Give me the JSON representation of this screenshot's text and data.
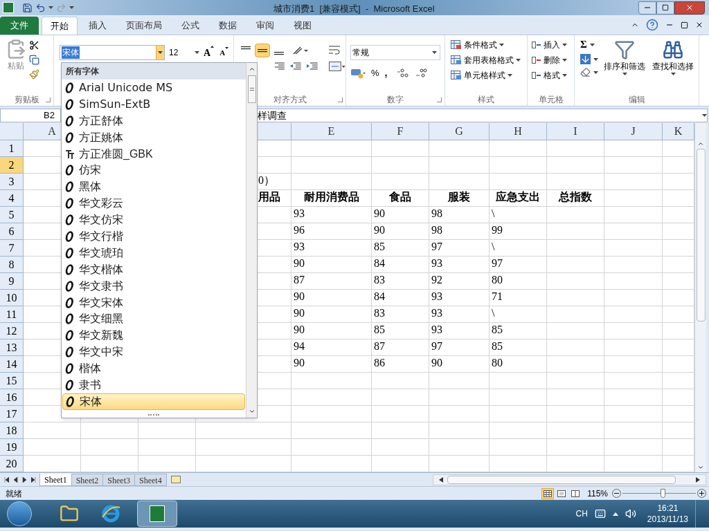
{
  "window": {
    "title": "城市消费1  [兼容模式]  -  Microsoft Excel"
  },
  "ribbon_tabs": [
    {
      "label": "文件",
      "kind": "file",
      "selected": false
    },
    {
      "label": "开始",
      "kind": "tab",
      "selected": true
    },
    {
      "label": "插入",
      "kind": "tab",
      "selected": false
    },
    {
      "label": "页面布局",
      "kind": "tab",
      "selected": false
    },
    {
      "label": "公式",
      "kind": "tab",
      "selected": false
    },
    {
      "label": "数据",
      "kind": "tab",
      "selected": false
    },
    {
      "label": "审阅",
      "kind": "tab",
      "selected": false
    },
    {
      "label": "视图",
      "kind": "tab",
      "selected": false
    }
  ],
  "clipboard": {
    "paste": "粘贴",
    "label": "剪贴板"
  },
  "font": {
    "name": "宋体",
    "size": "12",
    "grow": "A",
    "shrink": "A"
  },
  "alignment": {
    "label": "对齐方式",
    "vertical": [
      {
        "kind": "top",
        "selected": false
      },
      {
        "kind": "middle",
        "selected": true
      },
      {
        "kind": "bottom",
        "selected": false
      }
    ]
  },
  "number": {
    "format": "常规",
    "percent": "%",
    "comma": ",",
    "label": "数字"
  },
  "styles": {
    "items": [
      "条件格式",
      "套用表格格式",
      "单元格样式"
    ],
    "label": "样式"
  },
  "cells_group": {
    "items": [
      "插入",
      "删除",
      "格式"
    ],
    "label": "单元格"
  },
  "editing": {
    "sum": "Σ",
    "sort": "排序和筛选",
    "find": "查找和选择",
    "label": "编辑"
  },
  "name_box": "B2",
  "formula": "样调查",
  "columns": [
    "A",
    "E",
    "F",
    "G",
    "H",
    "I",
    "J",
    "K"
  ],
  "row_headers": [
    {
      "label": "1",
      "selected": false
    },
    {
      "label": "2",
      "selected": true
    },
    {
      "label": "3",
      "selected": false
    },
    {
      "label": "4",
      "selected": false
    },
    {
      "label": "5",
      "selected": false
    },
    {
      "label": "6",
      "selected": false
    },
    {
      "label": "7",
      "selected": false
    },
    {
      "label": "8",
      "selected": false
    },
    {
      "label": "9",
      "selected": false
    },
    {
      "label": "10",
      "selected": false
    },
    {
      "label": "11",
      "selected": false
    },
    {
      "label": "12",
      "selected": false
    },
    {
      "label": "13",
      "selected": false
    },
    {
      "label": "14",
      "selected": false
    },
    {
      "label": "15",
      "selected": false
    },
    {
      "label": "16",
      "selected": false
    },
    {
      "label": "17",
      "selected": false
    },
    {
      "label": "18",
      "selected": false
    },
    {
      "label": "19",
      "selected": false
    },
    {
      "label": "20",
      "selected": false
    }
  ],
  "sheet": {
    "title_fragment": "0）",
    "header_row": [
      "用品",
      "耐用消费品",
      "食品",
      "服装",
      "应急支出",
      "总指数"
    ],
    "data_rows": [
      [
        "93",
        "90",
        "98",
        "\\"
      ],
      [
        "96",
        "90",
        "98",
        "99"
      ],
      [
        "93",
        "85",
        "97",
        "\\"
      ],
      [
        "90",
        "84",
        "93",
        "97"
      ],
      [
        "87",
        "83",
        "92",
        "80"
      ],
      [
        "90",
        "84",
        "93",
        "71"
      ],
      [
        "90",
        "83",
        "93",
        "\\"
      ],
      [
        "90",
        "85",
        "93",
        "85"
      ],
      [
        "94",
        "87",
        "97",
        "85"
      ],
      [
        "90",
        "86",
        "90",
        "80"
      ]
    ]
  },
  "font_dropdown": {
    "heading": "所有字体",
    "items": [
      {
        "name": "Arial Unicode MS",
        "kind": "opentype",
        "selected": false
      },
      {
        "name": "SimSun-ExtB",
        "kind": "opentype",
        "selected": false
      },
      {
        "name": "方正舒体",
        "kind": "opentype",
        "selected": false
      },
      {
        "name": "方正姚体",
        "kind": "opentype",
        "selected": false
      },
      {
        "name": "方正准圆_GBK",
        "kind": "truetype",
        "selected": false
      },
      {
        "name": "仿宋",
        "kind": "opentype",
        "selected": false
      },
      {
        "name": "黑体",
        "kind": "opentype",
        "selected": false
      },
      {
        "name": "华文彩云",
        "kind": "opentype",
        "selected": false
      },
      {
        "name": "华文仿宋",
        "kind": "opentype",
        "selected": false
      },
      {
        "name": "华文行楷",
        "kind": "opentype",
        "selected": false
      },
      {
        "name": "华文琥珀",
        "kind": "opentype",
        "selected": false
      },
      {
        "name": "华文楷体",
        "kind": "opentype",
        "selected": false
      },
      {
        "name": "华文隶书",
        "kind": "opentype",
        "selected": false
      },
      {
        "name": "华文宋体",
        "kind": "opentype",
        "selected": false
      },
      {
        "name": "华文细黑",
        "kind": "opentype",
        "selected": false
      },
      {
        "name": "华文新魏",
        "kind": "opentype",
        "selected": false
      },
      {
        "name": "华文中宋",
        "kind": "opentype",
        "selected": false
      },
      {
        "name": "楷体",
        "kind": "opentype",
        "selected": false
      },
      {
        "name": "隶书",
        "kind": "opentype",
        "selected": false
      },
      {
        "name": "宋体",
        "kind": "opentype",
        "selected": true
      }
    ]
  },
  "sheet_tabs": [
    {
      "label": "Sheet1",
      "selected": true
    },
    {
      "label": "Sheet2",
      "selected": false
    },
    {
      "label": "Sheet3",
      "selected": false
    },
    {
      "label": "Sheet4",
      "selected": false
    }
  ],
  "status_bar": {
    "text": "就绪",
    "views": [
      {
        "kind": "normal",
        "selected": true
      },
      {
        "kind": "layout",
        "selected": false
      },
      {
        "kind": "break",
        "selected": false
      }
    ],
    "zoom": "115%",
    "level": 0.55
  },
  "taskbar": {
    "ime": "CH",
    "time": "16:21",
    "date": "2013/11/13"
  }
}
